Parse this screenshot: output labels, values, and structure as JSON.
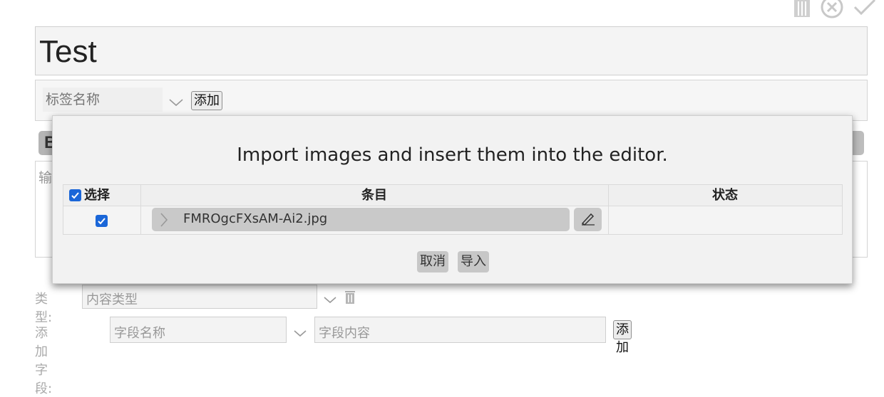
{
  "toolbar": {
    "icons": [
      "trash-icon",
      "close-circle-icon",
      "check-icon"
    ]
  },
  "note": {
    "title": "Test"
  },
  "tags": {
    "placeholder": "标签名称",
    "add_label": "添加"
  },
  "background": {
    "chip_partial": "B",
    "editor_placeholder_partial": "输"
  },
  "form": {
    "type_label": "类型:",
    "type_placeholder": "内容类型",
    "field_label": "添加字段:",
    "field_name_placeholder": "字段名称",
    "field_content_placeholder": "字段内容",
    "field_add_label": "添加"
  },
  "dialog": {
    "title": "Import images and insert them into the editor.",
    "columns": {
      "select": "选择",
      "item": "条目",
      "status": "状态"
    },
    "rows": [
      {
        "checked": true,
        "file_name": "FMROgcFXsAM-Ai2.jpg",
        "status": ""
      }
    ],
    "cancel_label": "取消",
    "import_label": "导入"
  },
  "colors": {
    "checkbox_accent": "#1a66d8"
  }
}
